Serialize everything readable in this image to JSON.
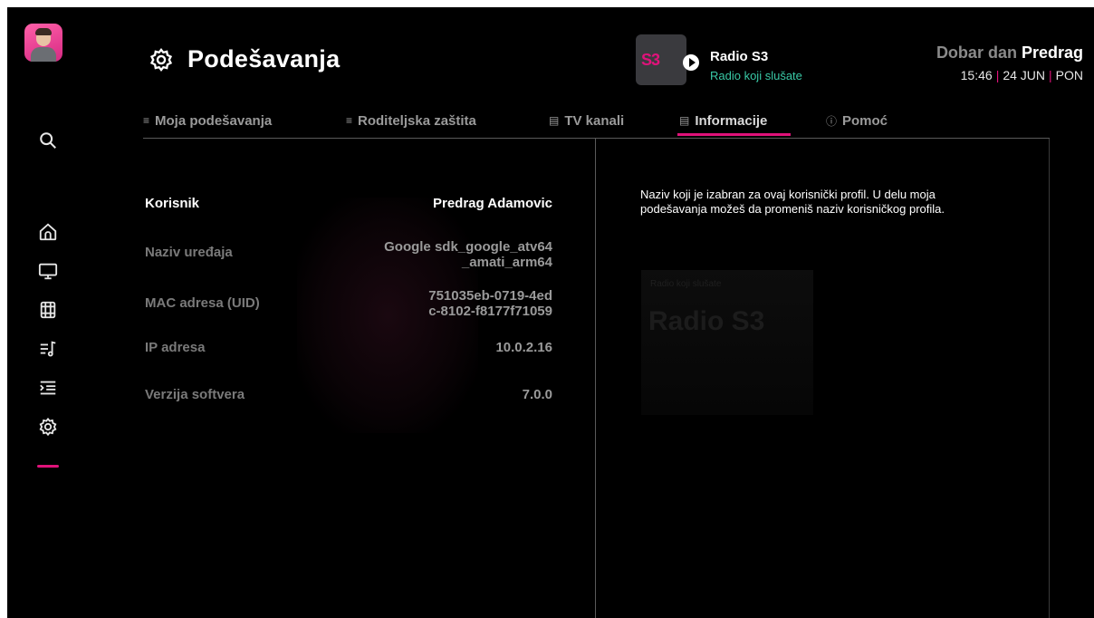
{
  "header": {
    "title": "Podešavanja",
    "radio": {
      "logo_text": "S3",
      "name": "Radio S3",
      "subtitle": "Radio koji slušate"
    },
    "greeting": {
      "prefix": "Dobar dan",
      "name": "Predrag"
    },
    "time": "15:46",
    "date": "24 JUN",
    "day": "PON"
  },
  "tabs": [
    {
      "label": "Moja podešavanja",
      "icon": "user-settings-icon"
    },
    {
      "label": "Roditeljska zaštita",
      "icon": "parental-lock-icon"
    },
    {
      "label": "TV kanali",
      "icon": "channel-list-icon"
    },
    {
      "label": "Informacije",
      "icon": "info-doc-icon",
      "active": true
    },
    {
      "label": "Pomoć",
      "icon": "help-icon"
    }
  ],
  "info": [
    {
      "label": "Korisnik",
      "value": "Predrag Adamovic"
    },
    {
      "label": "Naziv uređaja",
      "value": "Google sdk_google_atv64\n_amati_arm64"
    },
    {
      "label": "MAC adresa (UID)",
      "value": "751035eb-0719-4ed\nc-8102-f8177f71059"
    },
    {
      "label": "IP adresa",
      "value": "10.0.2.16"
    },
    {
      "label": "Verzija softvera",
      "value": "7.0.0"
    }
  ],
  "description": "Naziv koji je izabran za ovaj korisnički profil. U delu moja podešavanja možeš da promeniš naziv korisničkog profila.",
  "background": {
    "card_subtitle": "Radio koji slušate",
    "card_title": "Radio S3"
  },
  "colors": {
    "accent": "#e0127a",
    "radio_subtitle": "#39c9a6",
    "background": "#000000"
  }
}
